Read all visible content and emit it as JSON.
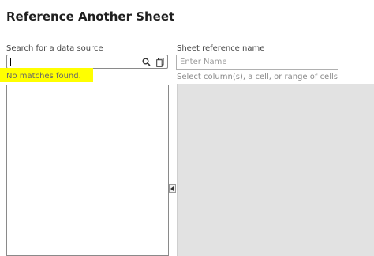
{
  "dialog": {
    "title": "Reference Another Sheet"
  },
  "search": {
    "label": "Search for a data source",
    "value": "",
    "placeholder": "",
    "no_results": "No matches found.",
    "icons": [
      "search-icon",
      "copy-icon"
    ]
  },
  "reference_name": {
    "label": "Sheet reference name",
    "value": "",
    "placeholder": "Enter Name"
  },
  "range_selector": {
    "hint": "Select column(s), a cell, or range of cells"
  },
  "colors": {
    "highlight": "#ffff00",
    "grid_background": "#e2e2e2"
  }
}
